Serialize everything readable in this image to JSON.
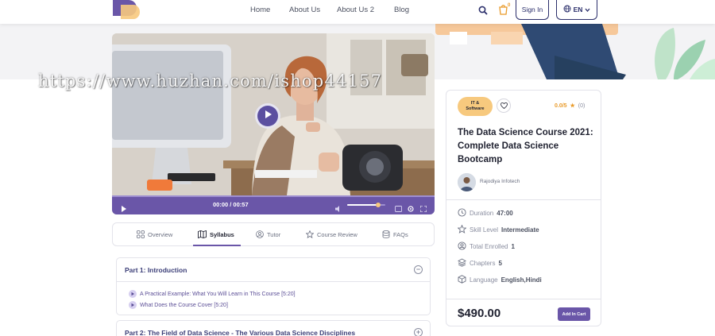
{
  "nav": {
    "links": [
      "Home",
      "About Us",
      "About Us 2",
      "Blog"
    ],
    "cart_count": "0",
    "signin_label": "Sign In",
    "lang_label": "EN"
  },
  "watermark": "https://www.huzhan.com/ishop44157",
  "video": {
    "time": "00:00 / 00:57",
    "volume_level": 0.82
  },
  "tabs": [
    {
      "label": "Overview",
      "icon": "grid-icon"
    },
    {
      "label": "Syllabus",
      "icon": "map-icon",
      "active": true
    },
    {
      "label": "Tutor",
      "icon": "user-circle-icon"
    },
    {
      "label": "Course Review",
      "icon": "star-icon"
    },
    {
      "label": "FAQs",
      "icon": "database-icon"
    }
  ],
  "syllabus": {
    "part1": {
      "title": "Part 1: Introduction",
      "lessons": [
        "A Practical Example: What You Will Learn in This Course [5:20]",
        "What Does the Course Cover [5:20]"
      ]
    },
    "part2": {
      "title": "Part 2: The Field of Data Science - The Various Data Science Disciplines"
    }
  },
  "course": {
    "category_line1": "IT &",
    "category_line2": "Software",
    "rating": "0.0/5",
    "rating_count": "(0)",
    "title": "The Data Science Course 2021: Complete Data Science Bootcamp",
    "author": "Rajodiya Infotech",
    "meta": [
      {
        "icon": "clock-icon",
        "label": "Duration",
        "value": "47:00"
      },
      {
        "icon": "star-outline-icon",
        "label": "Skill Level",
        "value": "Intermediate"
      },
      {
        "icon": "users-icon",
        "label": "Total Enrolled",
        "value": "1"
      },
      {
        "icon": "layers-icon",
        "label": "Chapters",
        "value": "5"
      },
      {
        "icon": "cube-icon",
        "label": "Language",
        "value": "English,Hindi"
      }
    ],
    "price": "$490.00",
    "add_to_cart_label": "Add In Cart"
  },
  "colors": {
    "accent": "#6a56a8",
    "navy": "#2b2f6b",
    "badge": "#f7c97e",
    "rating": "#e99b2b"
  }
}
